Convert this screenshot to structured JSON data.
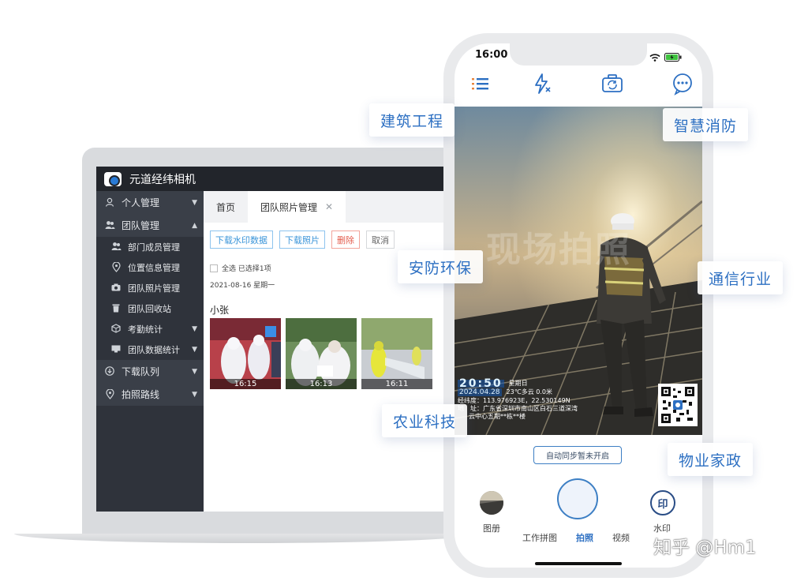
{
  "laptop": {
    "app_title": "元道经纬相机",
    "sidebar": [
      {
        "label": "个人管理",
        "icon": "person-icon",
        "level": "top",
        "expanded": false
      },
      {
        "label": "团队管理",
        "icon": "team-icon",
        "level": "top",
        "expanded": true
      },
      {
        "label": "部门成员管理",
        "icon": "members-icon",
        "level": "sub"
      },
      {
        "label": "位置信息管理",
        "icon": "location-pin-icon",
        "level": "sub"
      },
      {
        "label": "团队照片管理",
        "icon": "camera-icon",
        "level": "sub"
      },
      {
        "label": "团队回收站",
        "icon": "trash-icon",
        "level": "sub"
      },
      {
        "label": "考勤统计",
        "icon": "box-icon",
        "level": "sub",
        "has_arrow": true
      },
      {
        "label": "团队数据统计",
        "icon": "chart-icon",
        "level": "sub",
        "has_arrow": true
      },
      {
        "label": "下载队列",
        "icon": "download-icon",
        "level": "top",
        "expanded": false
      },
      {
        "label": "拍照路线",
        "icon": "route-pin-icon",
        "level": "top",
        "expanded": false
      }
    ],
    "tabs": {
      "home": "首页",
      "photos": "团队照片管理"
    },
    "buttons": {
      "download_watermark": "下载水印数据",
      "download_photos": "下载照片",
      "delete": "删除",
      "cancel": "取消"
    },
    "select_all": "全选 已选择1项",
    "date_line": "2021-08-16 星期一",
    "person_name": "小张",
    "thumbnails": [
      {
        "time": "16:15"
      },
      {
        "time": "16:13"
      },
      {
        "time": "16:11"
      }
    ]
  },
  "phone": {
    "status_time": "16:00",
    "toolbar_icons": [
      "menu-list-icon",
      "flash-off-icon",
      "flip-camera-icon",
      "more-chat-icon"
    ],
    "watermark_overlay": "现场拍照",
    "stamp": {
      "clock": "20:50",
      "weekday": "星期日",
      "date": "2024.04.28",
      "weather": "23℃多云  0.0米",
      "coords_label": "经纬度：",
      "coords": "113.976923E，22.530149N",
      "address_label": "地　址：",
      "address": "广东省深圳市南山区白石三道深湾",
      "address2": "云中心五期**栋**楼"
    },
    "sync_button": "自动同步暂未开启",
    "bottom": {
      "album": "图册",
      "collage": "工作拼图",
      "photo": "拍照",
      "video": "视频",
      "watermark": "水印",
      "watermark_glyph": "印"
    }
  },
  "tags": {
    "construction": "建筑工程",
    "fire": "智慧消防",
    "security": "安防环保",
    "telecom": "通信行业",
    "agriculture": "农业科技",
    "property": "物业家政"
  },
  "footer_watermark": "知乎 @Hm1",
  "colors": {
    "accent_blue": "#2c6fc2",
    "sidebar_bg": "#2f333b",
    "header_bg": "#22252b",
    "btn_blue": "#3b95d9",
    "btn_red": "#e35c4d"
  }
}
